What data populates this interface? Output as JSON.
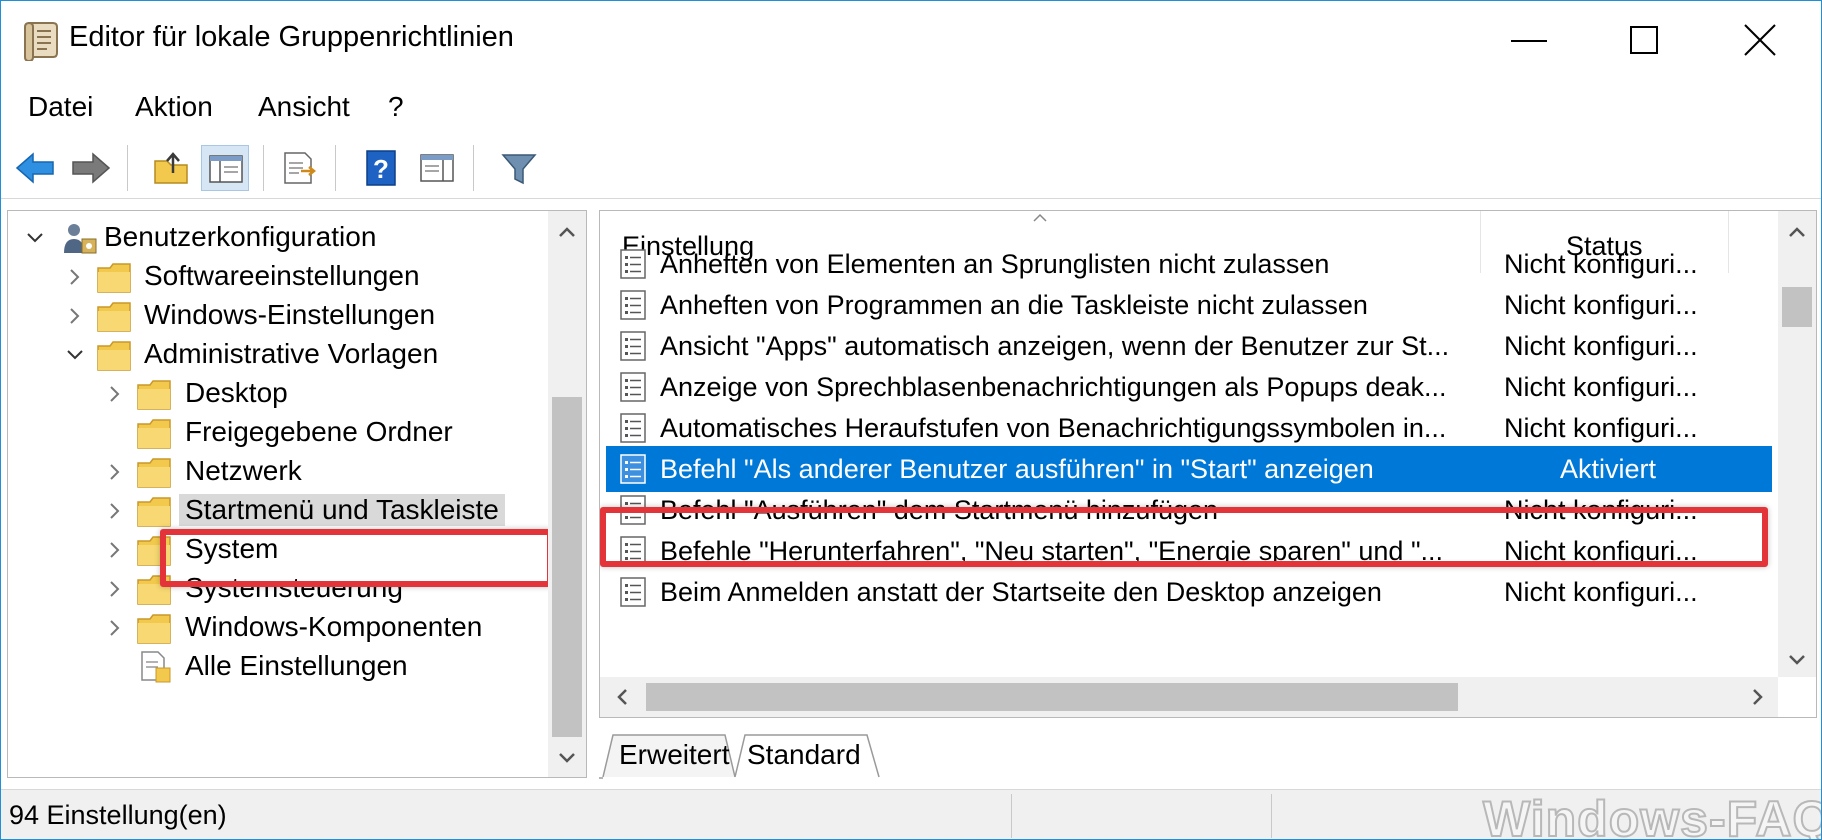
{
  "window": {
    "title": "Editor für lokale Gruppenrichtlinien",
    "controls": [
      "minimize",
      "maximize",
      "close"
    ]
  },
  "menu": {
    "items": [
      "Datei",
      "Aktion",
      "Ansicht",
      "?"
    ]
  },
  "toolbar": {
    "buttons": [
      "back-arrow-icon",
      "forward-arrow-icon",
      "up-folder-icon",
      "show-hide-tree-icon",
      "export-list-icon",
      "help-icon",
      "show-hide-action-pane-icon",
      "filter-icon"
    ]
  },
  "tree": {
    "items": [
      {
        "label": "Benutzerkonfiguration",
        "level": 0,
        "expanded": true
      },
      {
        "label": "Softwareeinstellungen",
        "level": 1,
        "expanded": false
      },
      {
        "label": "Windows-Einstellungen",
        "level": 1,
        "expanded": false
      },
      {
        "label": "Administrative Vorlagen",
        "level": 1,
        "expanded": true
      },
      {
        "label": "Desktop",
        "level": 2,
        "expanded": false
      },
      {
        "label": "Freigegebene Ordner",
        "level": 2,
        "expanded": null
      },
      {
        "label": "Netzwerk",
        "level": 2,
        "expanded": false
      },
      {
        "label": "Startmenü und Taskleiste",
        "level": 2,
        "expanded": false,
        "selected": true
      },
      {
        "label": "System",
        "level": 2,
        "expanded": false
      },
      {
        "label": "Systemsteuerung",
        "level": 2,
        "expanded": false
      },
      {
        "label": "Windows-Komponenten",
        "level": 2,
        "expanded": false
      },
      {
        "label": "Alle Einstellungen",
        "level": 2,
        "expanded": null
      }
    ]
  },
  "list": {
    "columns": {
      "setting": "Einstellung",
      "status": "Status"
    },
    "rows": [
      {
        "setting": "Anheften von Elementen an Sprunglisten nicht zulassen",
        "status": "Nicht konfiguri..."
      },
      {
        "setting": "Anheften von Programmen an die Taskleiste nicht zulassen",
        "status": "Nicht konfiguri..."
      },
      {
        "setting": "Ansicht \"Apps\" automatisch anzeigen, wenn der Benutzer zur St...",
        "status": "Nicht konfiguri..."
      },
      {
        "setting": "Anzeige von Sprechblasenbenachrichtigungen als Popups deak...",
        "status": "Nicht konfiguri..."
      },
      {
        "setting": "Automatisches Heraufstufen von Benachrichtigungssymbolen in...",
        "status": "Nicht konfiguri..."
      },
      {
        "setting": "Befehl \"Als anderer Benutzer ausführen\" in \"Start\" anzeigen",
        "status": "Aktiviert",
        "selected": true
      },
      {
        "setting": "Befehl \"Ausführen\" dem Startmenü hinzufügen",
        "status": "Nicht konfiguri..."
      },
      {
        "setting": "Befehle \"Herunterfahren\", \"Neu starten\", \"Energie sparen\" und \"...",
        "status": "Nicht konfiguri..."
      },
      {
        "setting": "Beim Anmelden anstatt der Startseite den Desktop anzeigen",
        "status": "Nicht konfiguri..."
      }
    ]
  },
  "tabs": [
    {
      "label": "Erweitert",
      "active": false
    },
    {
      "label": "Standard",
      "active": true
    }
  ],
  "statusbar": {
    "text": "94 Einstellung(en)",
    "watermark": "Windows-FAQ"
  },
  "colors": {
    "selection": "#0078d7",
    "highlight_box": "#e3343a",
    "folder": "#f2c94c",
    "window_border": "#1f8fd8"
  }
}
